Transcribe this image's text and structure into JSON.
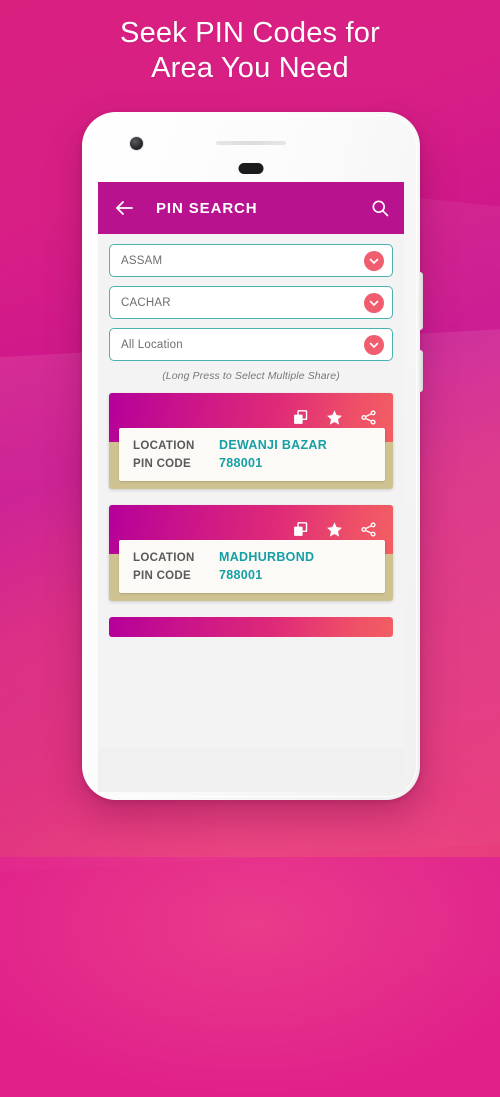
{
  "promo": {
    "headline_line1": "Seek PIN Codes for",
    "headline_line2": "Area You Need"
  },
  "app": {
    "appbar": {
      "back_icon": "arrow-left-icon",
      "title": "PIN SEARCH",
      "search_icon": "search-icon",
      "background_color": "#b9128f"
    },
    "filters": [
      {
        "name": "state",
        "value": "ASSAM",
        "chevron_icon": "chevron-down-icon"
      },
      {
        "name": "district",
        "value": "CACHAR",
        "chevron_icon": "chevron-down-icon"
      },
      {
        "name": "location",
        "value": "All Location",
        "chevron_icon": "chevron-down-icon"
      }
    ],
    "hint": "(Long Press to Select Multiple Share)",
    "card_actions": {
      "copy_icon": "copy-icon",
      "star_icon": "star-icon",
      "share_icon": "share-icon"
    },
    "labels": {
      "location": "LOCATION",
      "pin_code": "PIN CODE"
    },
    "results": [
      {
        "location": "DEWANJI BAZAR",
        "pin_code": "788001"
      },
      {
        "location": "MADHURBOND",
        "pin_code": "788001"
      }
    ],
    "colors": {
      "accent_teal": "#16a0a6",
      "accent_coral": "#ef5d6e",
      "card_band": "#cfc291",
      "brand_magenta": "#b9128f"
    }
  }
}
